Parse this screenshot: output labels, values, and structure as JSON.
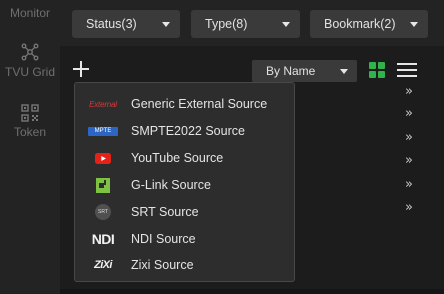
{
  "sidebar": {
    "items": [
      {
        "label": "Monitor",
        "icon": "monitor-icon"
      },
      {
        "label": "TVU Grid",
        "icon": "grid-network-icon"
      },
      {
        "label": "Token",
        "icon": "qr-code-icon"
      }
    ]
  },
  "filters": {
    "status": "Status(3)",
    "type": "Type(8)",
    "bookmark": "Bookmark(2)"
  },
  "toolbar": {
    "sort_value": "By Name",
    "view_grid_color": "#2fb34a"
  },
  "menu": {
    "items": [
      {
        "label": "Generic External Source",
        "icon": "external-icon",
        "icon_text": "External"
      },
      {
        "label": "SMPTE2022 Source",
        "icon": "smpte-icon",
        "icon_text": "MPTE"
      },
      {
        "label": "YouTube Source",
        "icon": "youtube-icon"
      },
      {
        "label": "G-Link Source",
        "icon": "glink-icon"
      },
      {
        "label": "SRT Source",
        "icon": "srt-icon",
        "icon_text": "SRT"
      },
      {
        "label": "NDI Source",
        "icon": "ndi-icon",
        "icon_text": "NDI"
      },
      {
        "label": "Zixi Source",
        "icon": "zixi-icon",
        "icon_text": "ZiXi"
      }
    ]
  },
  "colors": {
    "youtube": "#e62117",
    "glink": "#7dc242",
    "external": "#d33a3a"
  }
}
